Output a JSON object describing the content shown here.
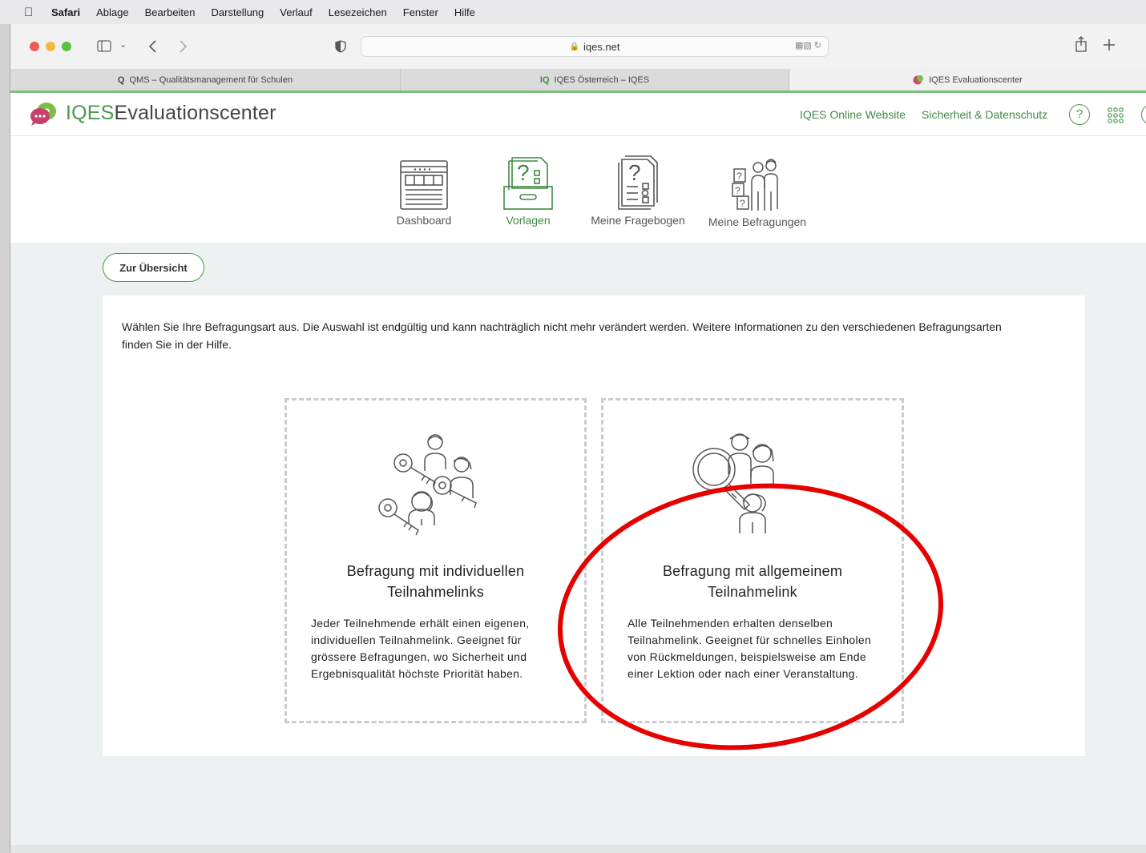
{
  "menubar": {
    "app_name": "Safari",
    "items": [
      "Ablage",
      "Bearbeiten",
      "Darstellung",
      "Verlauf",
      "Lesezeichen",
      "Fenster",
      "Hilfe"
    ]
  },
  "browser": {
    "url": "iqes.net",
    "tabs": [
      {
        "title": "QMS – Qualitätsmanagement für Schulen",
        "icon": "q-circle-icon",
        "active": false
      },
      {
        "title": "IQES Österreich – IQES",
        "icon": "iq-icon",
        "active": false
      },
      {
        "title": "IQES Evaluationscenter",
        "icon": "iqes-bubble-icon",
        "active": true
      }
    ]
  },
  "header": {
    "logo_prefix": "IQES",
    "logo_suffix": "Evaluationscenter",
    "links": [
      "IQES Online Website",
      "Sicherheit & Datenschutz"
    ],
    "help_label": "?"
  },
  "modules": [
    {
      "label": "Dashboard",
      "icon": "dashboard-icon",
      "active": false
    },
    {
      "label": "Vorlagen",
      "icon": "templates-icon",
      "active": true
    },
    {
      "label": "Meine Fragebogen",
      "icon": "questionnaire-icon",
      "active": false
    },
    {
      "label": "Meine Befragungen",
      "icon": "surveys-icon",
      "active": false
    }
  ],
  "content": {
    "back_button": "Zur Übersicht",
    "intro": "Wählen Sie Ihre Befragungsart aus. Die Auswahl ist endgültig und kann nachträglich nicht mehr verändert werden. Weitere Informationen zu den verschiedenen Befragungsarten finden Sie in der Hilfe.",
    "cards": [
      {
        "title_line1": "Befragung mit individuellen",
        "title_line2": "Teilnahmelinks",
        "description": "Jeder Teilnehmende erhält einen eigenen, individuellen Teilnahmelink. Geeignet für grössere Befragungen, wo Sicherheit und Ergebnisqualität höchste Priorität haben.",
        "icon": "keys-people-icon"
      },
      {
        "title_line1": "Befragung mit allgemeinem",
        "title_line2": "Teilnahmelink",
        "description": "Alle Teilnehmenden erhalten denselben Teilnahmelink. Geeignet für schnelles Einholen von Rückmeldungen, beispielsweise am Ende einer Lektion oder nach einer Veranstaltung.",
        "icon": "magnifier-people-icon"
      }
    ]
  },
  "colors": {
    "brand_green": "#4a9a4c",
    "annotation_red": "#e60000",
    "content_bg": "#eef1f1"
  }
}
